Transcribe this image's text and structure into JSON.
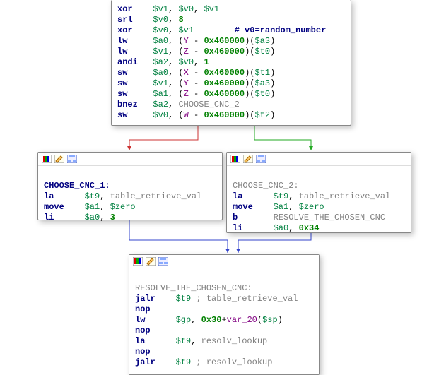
{
  "top": {
    "lines": [
      {
        "op": "xor",
        "args": "$v1, $v0, $v1",
        "c": ""
      },
      {
        "op": "srl",
        "args": "$v0, 8",
        "c": ""
      },
      {
        "op": "xor",
        "args": "$v0, $v1",
        "c": "# v0=random_number"
      },
      {
        "op": "lw",
        "args": "$a0, (Y - 0x460000)($a3)",
        "c": ""
      },
      {
        "op": "lw",
        "args": "$v1, (Z - 0x460000)($t0)",
        "c": ""
      },
      {
        "op": "andi",
        "args": "$a2, $v0, 1",
        "c": ""
      },
      {
        "op": "sw",
        "args": "$a0, (X - 0x460000)($t1)",
        "c": ""
      },
      {
        "op": "sw",
        "args": "$v1, (Y - 0x460000)($a3)",
        "c": ""
      },
      {
        "op": "sw",
        "args": "$a1, (Z - 0x460000)($t0)",
        "c": ""
      },
      {
        "op": "bnez",
        "args": "$a2, CHOOSE_CNC_2",
        "c": ""
      },
      {
        "op": "sw",
        "args": "$v0, (W - 0x460000)($t2)",
        "c": ""
      }
    ]
  },
  "left": {
    "title": "CHOOSE_CNC_1:",
    "lines": [
      {
        "op": "la",
        "args": "$t9, table_retrieve_val",
        "c": ""
      },
      {
        "op": "move",
        "args": "$a1, $zero",
        "c": ""
      },
      {
        "op": "li",
        "args": "$a0, 3",
        "c": ""
      }
    ]
  },
  "right": {
    "title": "CHOOSE_CNC_2:",
    "lines": [
      {
        "op": "la",
        "args": "$t9, table_retrieve_val",
        "c": ""
      },
      {
        "op": "move",
        "args": "$a1, $zero",
        "c": ""
      },
      {
        "op": "b",
        "args": "RESOLVE_THE_CHOSEN_CNC",
        "c": ""
      },
      {
        "op": "li",
        "args": "$a0, 0x34",
        "c": ""
      }
    ]
  },
  "bottom": {
    "title": "RESOLVE_THE_CHOSEN_CNC:",
    "lines": [
      {
        "op": "jalr",
        "args": "$t9",
        "c": "; table_retrieve_val"
      },
      {
        "op": "nop",
        "args": "",
        "c": ""
      },
      {
        "op": "lw",
        "args": "$gp, 0x30+var_20($sp)",
        "c": ""
      },
      {
        "op": "nop",
        "args": "",
        "c": ""
      },
      {
        "op": "la",
        "args": "$t9, resolv_lookup",
        "c": ""
      },
      {
        "op": "nop",
        "args": "",
        "c": ""
      },
      {
        "op": "jalr",
        "args": "$t9",
        "c": "; resolv_lookup"
      }
    ]
  },
  "icons": {
    "color": "color-icon",
    "edit": "edit-icon",
    "graph": "graph-icon"
  }
}
